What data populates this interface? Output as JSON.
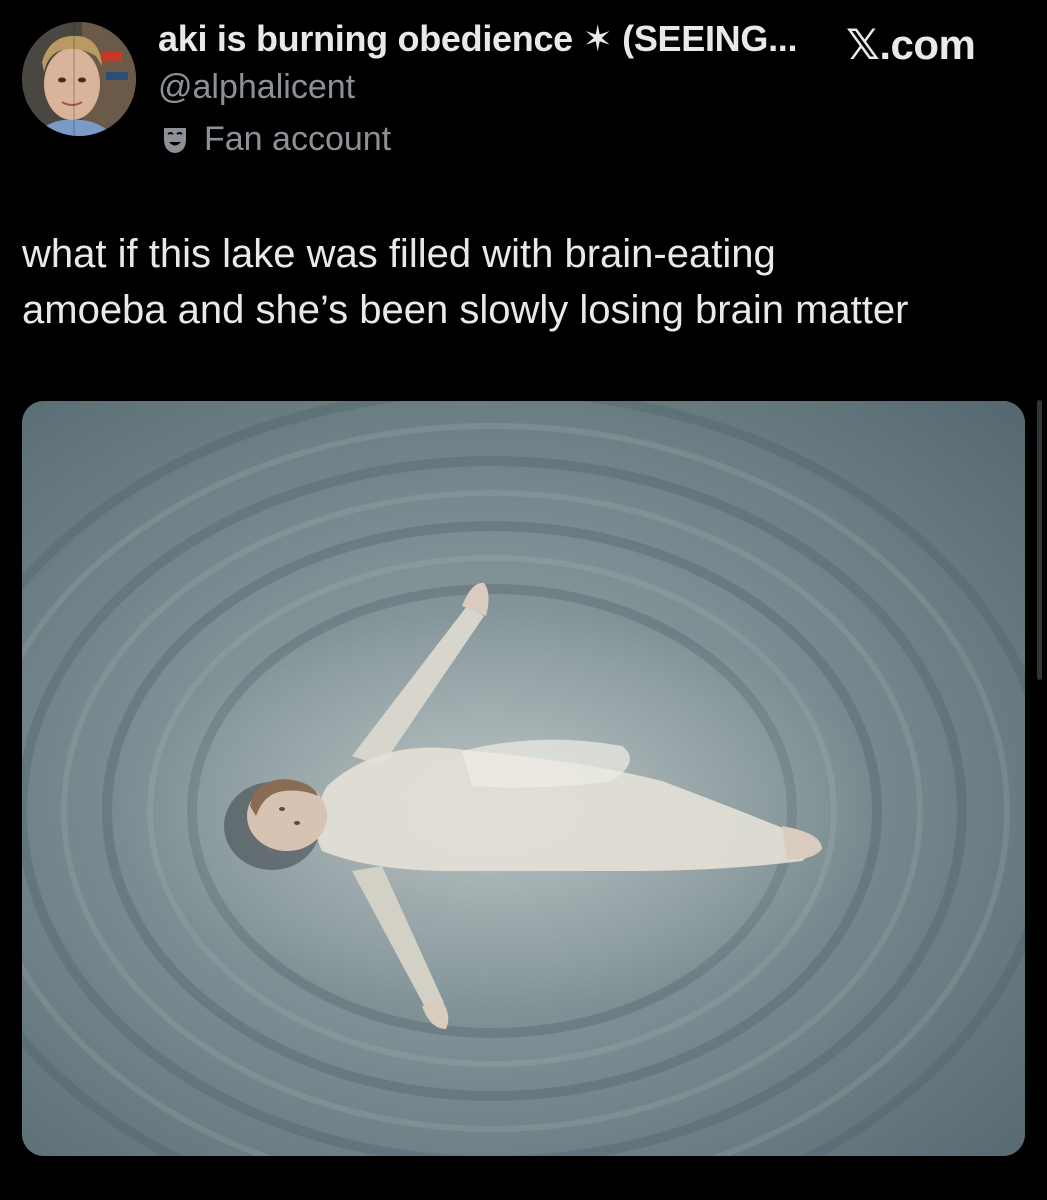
{
  "post": {
    "display_name": "aki is burning obedience ✶ (SEEING...",
    "handle": "@alphalicent",
    "affiliation_label": "Fan account",
    "site_logo": "𝕏.com",
    "text": "what if this lake was filled with brain-eating\namoeba and she’s been slowly losing brain matter"
  },
  "icons": {
    "avatar": "profile-photo",
    "affiliation": "theater-mask-icon"
  },
  "colors": {
    "background": "#000000",
    "primary_text": "#e7e9ea",
    "secondary_text": "#8b9196",
    "water": "#6b7f86"
  }
}
